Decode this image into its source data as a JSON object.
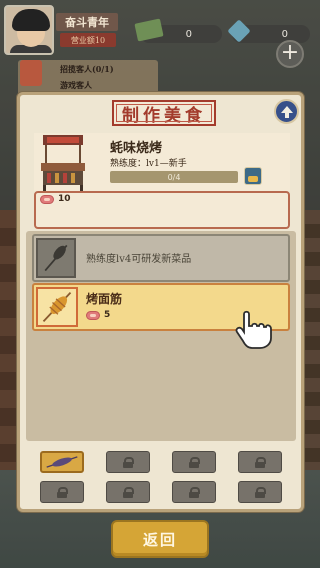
{
  "hud": {
    "player_name": "奋斗青年",
    "player_rank": "营业额10",
    "money": "0",
    "gems": "0",
    "add_symbol": "+",
    "tasks": [
      "招揽客人(0/1)",
      "游戏客人"
    ]
  },
  "dialog": {
    "title": "制作美食",
    "stall": {
      "name": "蚝味烧烤",
      "level": "熟练度：lv1—新手",
      "progress_text": "0/4",
      "progress_fraction": 0.0
    },
    "ingredient": {
      "icon": "meat-icon",
      "count": "10"
    },
    "recipes": [
      {
        "label": "熟练度lv4可研发新菜品",
        "locked": true
      },
      {
        "label": "烤面筋",
        "cost": "5",
        "locked": false
      }
    ],
    "slots": [
      {
        "active": true
      },
      {
        "active": false
      },
      {
        "active": false
      },
      {
        "active": false
      },
      {
        "active": false
      },
      {
        "active": false
      },
      {
        "active": false
      },
      {
        "active": false
      }
    ]
  },
  "footer": {
    "return_label": "返回"
  },
  "colors": {
    "title_red": "#a33b2c",
    "dialog_bg": "#eee6d2",
    "active_row": "#f3d98c",
    "button_gold": "#d5a536"
  }
}
